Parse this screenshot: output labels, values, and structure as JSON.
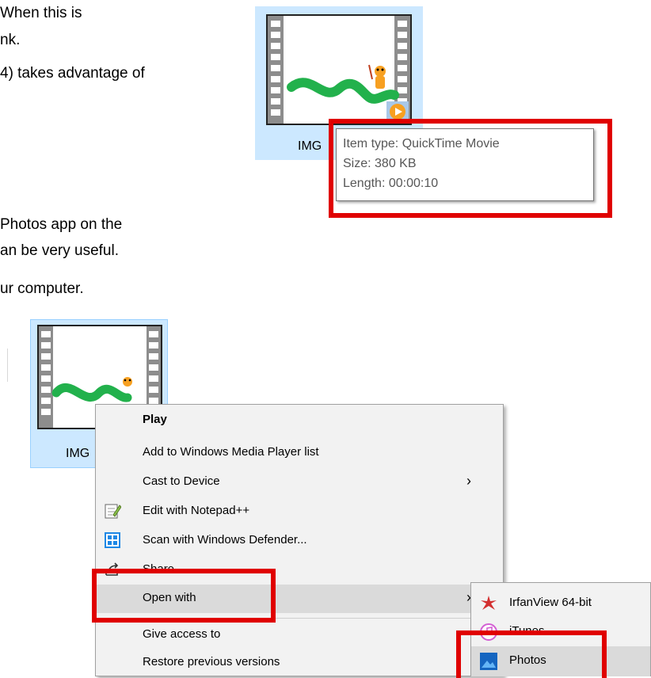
{
  "document": {
    "lines": [
      "When this is",
      "nk.",
      "4) takes advantage of",
      "Photos app on the",
      "an be very useful.",
      "ur computer."
    ]
  },
  "top_file": {
    "label": "IMG",
    "tooltip": {
      "item_type": "Item type: QuickTime Movie",
      "size": "Size: 380 KB",
      "length": "Length: 00:00:10"
    }
  },
  "bottom_file": {
    "label": "IMG"
  },
  "context_menu": {
    "items": [
      {
        "label": "Play",
        "icon": ""
      },
      {
        "label": "Add to Windows Media Player list",
        "icon": ""
      },
      {
        "label": "Cast to Device",
        "icon": "",
        "submenu": true
      },
      {
        "label": "Edit with Notepad++",
        "icon": "notepad-icon"
      },
      {
        "label": "Scan with Windows Defender...",
        "icon": "defender-shield-icon"
      },
      {
        "label": "Share",
        "icon": "share-icon"
      },
      {
        "label": "Open with",
        "icon": "",
        "submenu": true,
        "highlighted": true
      },
      {
        "label": "Give access to",
        "icon": ""
      },
      {
        "label": "Restore previous versions",
        "icon": ""
      }
    ]
  },
  "open_with_submenu": {
    "items": [
      {
        "label": "IrfanView 64-bit",
        "icon": "irfanview-icon"
      },
      {
        "label": "iTunes",
        "icon": "itunes-icon"
      },
      {
        "label": "Photos",
        "icon": "photos-icon",
        "highlighted": true
      }
    ]
  },
  "colors": {
    "highlight_red": "#e00000",
    "selection_blue": "#cce8ff",
    "menu_background": "#f2f2f2",
    "menu_hover": "#dadada",
    "snake_green": "#22b14c",
    "play_badge_orange": "#f7a021"
  }
}
